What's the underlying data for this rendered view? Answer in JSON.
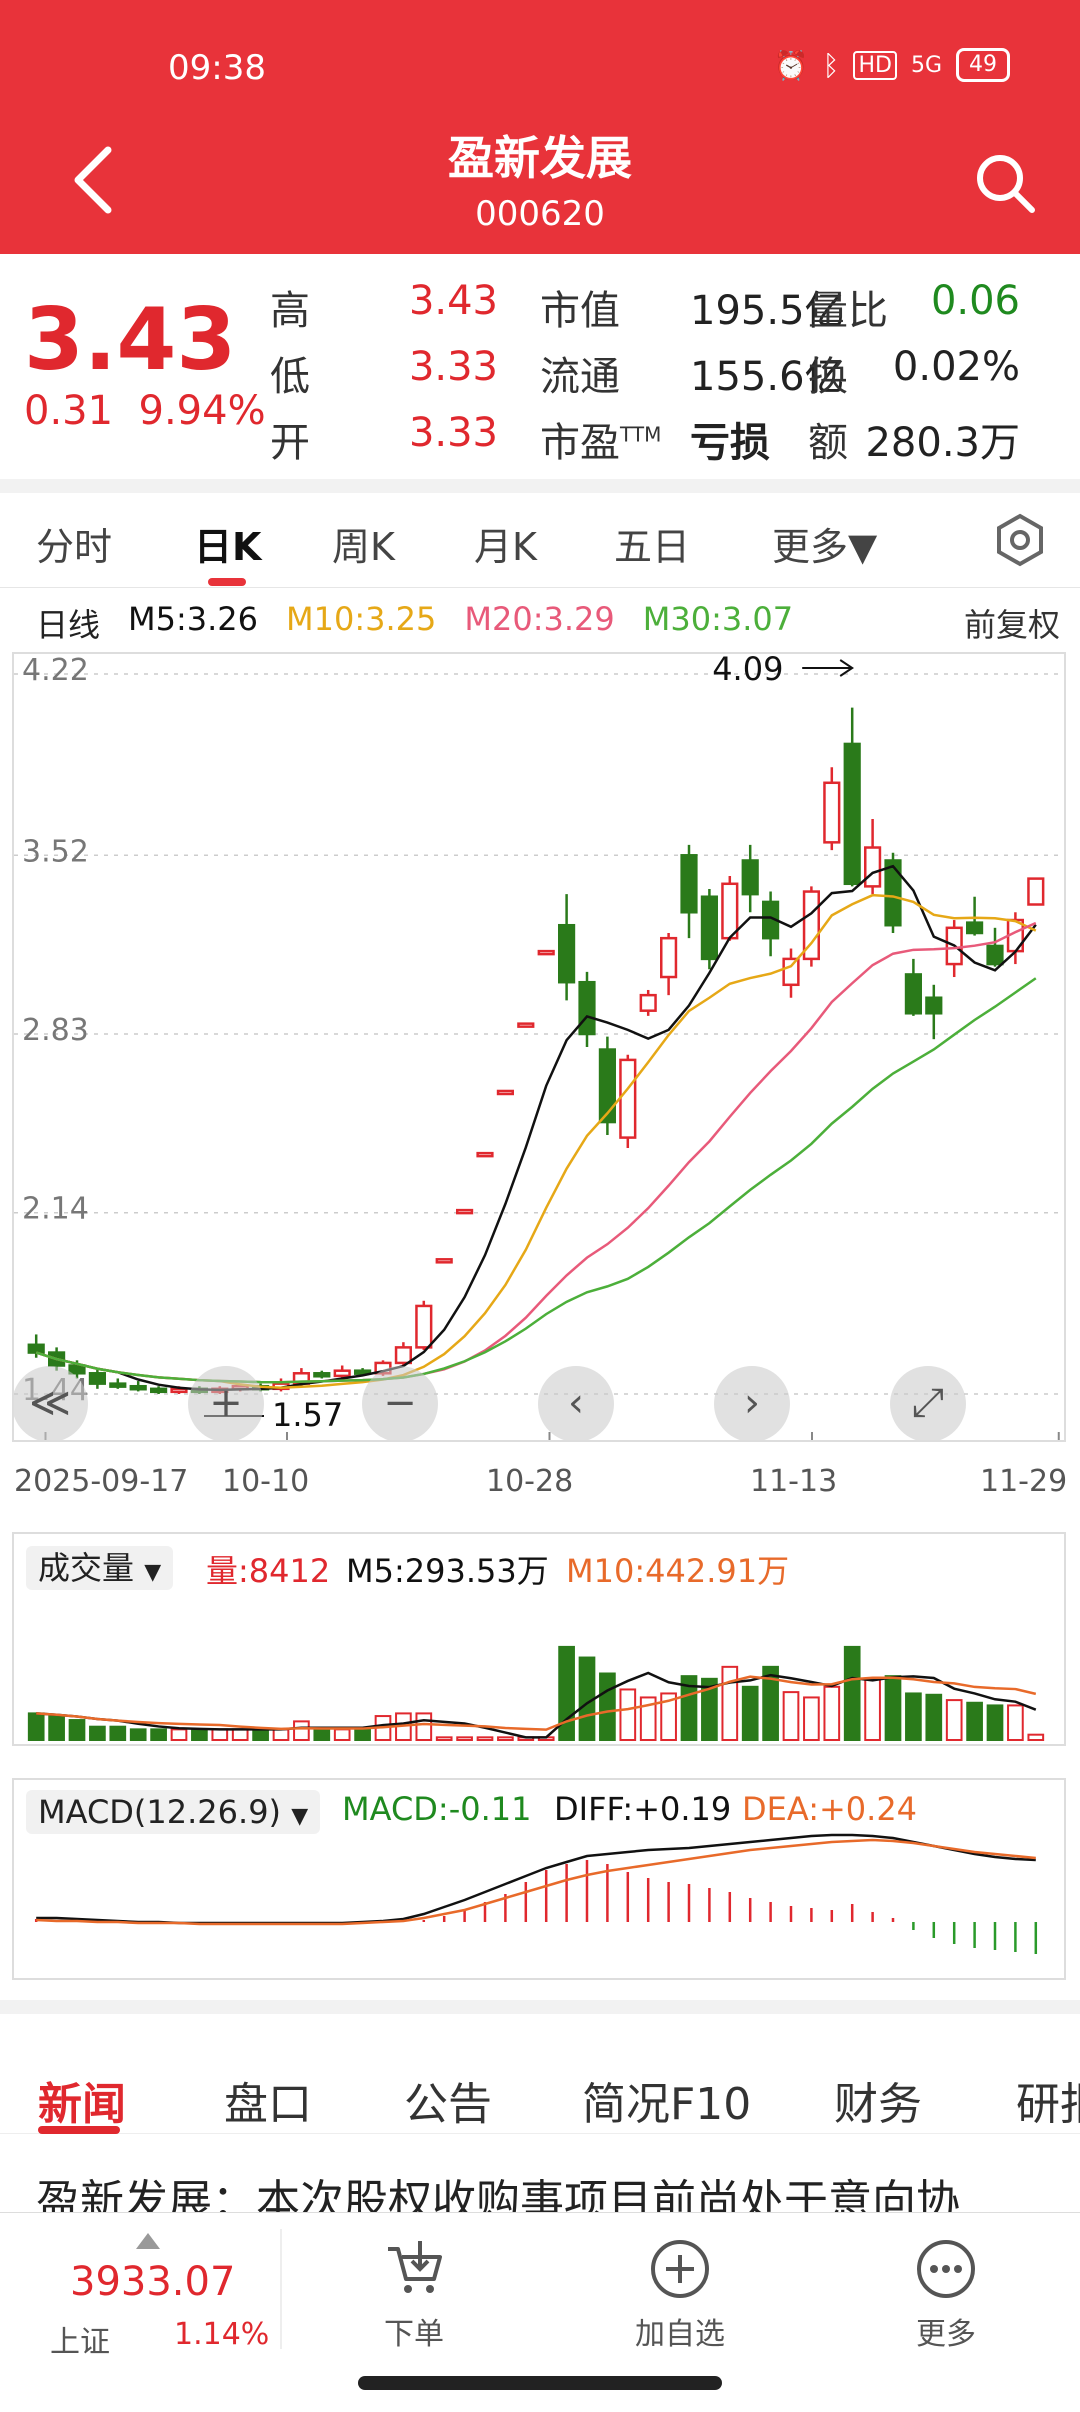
{
  "status_bar": {
    "time": "09:38",
    "signal": "5G",
    "hd": "HD",
    "battery": "49"
  },
  "header": {
    "title": "盈新发展",
    "code": "000620"
  },
  "quote": {
    "price": "3.43",
    "change": "0.31",
    "change_pct": "9.94%",
    "rows": [
      {
        "l1": "高",
        "v1": "3.43",
        "l2": "市值",
        "v2": "195.5亿",
        "l3": "量比",
        "v3": "0.06"
      },
      {
        "l1": "低",
        "v1": "3.33",
        "l2": "流通",
        "v2": "155.6亿",
        "l3": "换",
        "v3": "0.02%"
      },
      {
        "l1": "开",
        "v1": "3.33",
        "l2": "市盈TTM",
        "v2": "亏损",
        "l3": "额",
        "v3": "280.3万"
      }
    ]
  },
  "k_tabs": [
    "分时",
    "日K",
    "周K",
    "月K",
    "五日",
    "更多▼"
  ],
  "ma_legend": {
    "label": "日线",
    "m5": "M5:3.26",
    "m10": "M10:3.25",
    "m20": "M20:3.29",
    "m30": "M30:3.07",
    "right": "前复权"
  },
  "colors": {
    "red": "#e0282e",
    "green": "#2a7a1a",
    "ma5": "#111111",
    "ma10": "#e6a817",
    "ma20": "#e85a7a",
    "ma30": "#4caf3a",
    "header": "#e8333a"
  },
  "chart_data": {
    "type": "candlestick",
    "y_ticks": [
      "4.22",
      "3.52",
      "2.83",
      "2.14",
      "1.44"
    ],
    "ylim": [
      1.44,
      4.22
    ],
    "x_labels": [
      "2025-09-17",
      "10-10",
      "10-28",
      "11-13",
      "11-29"
    ],
    "high_label": "4.09",
    "low_label": "1.57",
    "candles": [
      [
        1.63,
        1.6,
        1.67,
        1.58
      ],
      [
        1.6,
        1.55,
        1.62,
        1.53
      ],
      [
        1.55,
        1.52,
        1.57,
        1.5
      ],
      [
        1.52,
        1.48,
        1.54,
        1.46
      ],
      [
        1.48,
        1.47,
        1.5,
        1.46
      ],
      [
        1.47,
        1.46,
        1.49,
        1.45
      ],
      [
        1.46,
        1.45,
        1.47,
        1.44
      ],
      [
        1.45,
        1.46,
        1.47,
        1.44
      ],
      [
        1.46,
        1.45,
        1.47,
        1.44
      ],
      [
        1.45,
        1.46,
        1.47,
        1.44
      ],
      [
        1.46,
        1.47,
        1.48,
        1.45
      ],
      [
        1.47,
        1.46,
        1.48,
        1.45
      ],
      [
        1.46,
        1.48,
        1.5,
        1.45
      ],
      [
        1.48,
        1.52,
        1.54,
        1.47
      ],
      [
        1.52,
        1.51,
        1.53,
        1.5
      ],
      [
        1.51,
        1.53,
        1.55,
        1.5
      ],
      [
        1.53,
        1.52,
        1.54,
        1.51
      ],
      [
        1.52,
        1.56,
        1.57,
        1.51
      ],
      [
        1.56,
        1.62,
        1.64,
        1.55
      ],
      [
        1.62,
        1.78,
        1.8,
        1.61
      ],
      [
        1.96,
        1.96,
        1.96,
        1.96
      ],
      [
        2.15,
        2.15,
        2.15,
        2.15
      ],
      [
        2.37,
        2.37,
        2.37,
        2.37
      ],
      [
        2.61,
        2.61,
        2.61,
        2.61
      ],
      [
        2.87,
        2.87,
        2.87,
        2.87
      ],
      [
        3.15,
        3.15,
        3.15,
        3.15
      ],
      [
        3.25,
        3.03,
        3.37,
        2.96
      ],
      [
        3.03,
        2.83,
        3.07,
        2.78
      ],
      [
        2.77,
        2.49,
        2.82,
        2.44
      ],
      [
        2.43,
        2.73,
        2.75,
        2.39
      ],
      [
        2.92,
        2.98,
        3.0,
        2.9
      ],
      [
        3.05,
        3.2,
        3.22,
        2.98
      ],
      [
        3.52,
        3.3,
        3.56,
        3.2
      ],
      [
        3.36,
        3.12,
        3.39,
        3.08
      ],
      [
        3.2,
        3.41,
        3.44,
        3.19
      ],
      [
        3.5,
        3.37,
        3.56,
        3.3
      ],
      [
        3.34,
        3.2,
        3.38,
        3.13
      ],
      [
        3.02,
        3.12,
        3.16,
        2.97
      ],
      [
        3.12,
        3.38,
        3.4,
        3.09
      ],
      [
        3.57,
        3.8,
        3.86,
        3.54
      ],
      [
        3.95,
        3.41,
        4.09,
        3.4
      ],
      [
        3.4,
        3.55,
        3.66,
        3.37
      ],
      [
        3.5,
        3.25,
        3.53,
        3.22
      ],
      [
        3.06,
        2.91,
        3.12,
        2.9
      ],
      [
        2.97,
        2.91,
        3.02,
        2.81
      ],
      [
        3.1,
        3.24,
        3.27,
        3.05
      ],
      [
        3.26,
        3.22,
        3.36,
        3.21
      ],
      [
        3.17,
        3.1,
        3.24,
        3.09
      ],
      [
        3.15,
        3.27,
        3.3,
        3.1
      ],
      [
        3.33,
        3.43,
        3.43,
        3.33
      ]
    ]
  },
  "volume": {
    "label": "成交量",
    "vol": "量:8412",
    "m5": "M5:293.53万",
    "m10": "M10:442.91万"
  },
  "macd": {
    "label": "MACD(12.26.9)",
    "macd": "MACD:-0.11",
    "diff": "DIFF:+0.19",
    "dea": "DEA:+0.24"
  },
  "news_tabs": [
    "新闻",
    "盘口",
    "公告",
    "简况F10",
    "财务",
    "研报"
  ],
  "headline": "盈新发展：本次股权收购事项目前尚处于意向协",
  "bottom": {
    "index_value": "3933.07",
    "index_name": "上证",
    "index_pct": "1.14%",
    "order": "下单",
    "add_watch": "加自选",
    "more": "更多"
  }
}
